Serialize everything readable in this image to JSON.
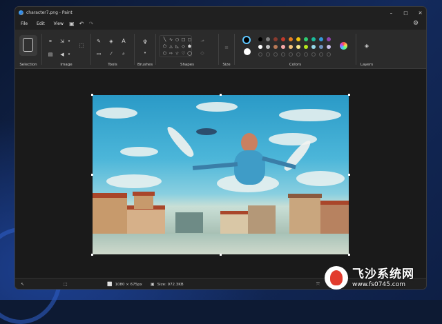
{
  "window": {
    "title": "character7.png - Paint",
    "min": "–",
    "max": "□",
    "close": "✕"
  },
  "menu": {
    "file": "File",
    "edit": "Edit",
    "view": "View"
  },
  "ribbon": {
    "groups": {
      "selection": "Selection",
      "image": "Image",
      "tools": "Tools",
      "brushes": "Brushes",
      "shapes": "Shapes",
      "size": "Size",
      "colors": "Colors",
      "layers": "Layers"
    },
    "palette_row1": [
      "#000000",
      "#7f7f7f",
      "#883a2e",
      "#c0392b",
      "#e67e22",
      "#f1c40f",
      "#2ecc71",
      "#1abc9c",
      "#3498db",
      "#8e44ad"
    ],
    "palette_row2": [
      "#ffffff",
      "#c3c3c3",
      "#b97a57",
      "#f7a8a8",
      "#f5c27a",
      "#f7e58c",
      "#b5e61d",
      "#99d9ea",
      "#7092be",
      "#c8bfe7"
    ],
    "primary_color": "#000000",
    "secondary_color": "#ffffff",
    "accent_color": "#5ec6ff"
  },
  "status": {
    "dimensions": "1080 × 675px",
    "size": "Size: 972.3KB"
  },
  "watermark": {
    "cn": "飞沙系统网",
    "url": "www.fs0745.com"
  }
}
